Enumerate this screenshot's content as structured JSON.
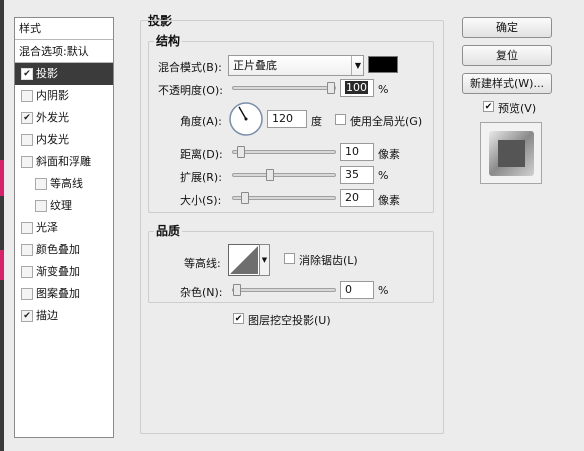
{
  "window": {
    "accent_color": "#3b3b3b"
  },
  "sidebar": {
    "header": "样式",
    "items": [
      {
        "label": "混合选项:默认",
        "checkbox": false,
        "checked": false,
        "selected": false
      },
      {
        "label": "投影",
        "checkbox": true,
        "checked": true,
        "selected": true
      },
      {
        "label": "内阴影",
        "checkbox": true,
        "checked": false,
        "selected": false
      },
      {
        "label": "外发光",
        "checkbox": true,
        "checked": true,
        "selected": false
      },
      {
        "label": "内发光",
        "checkbox": true,
        "checked": false,
        "selected": false
      },
      {
        "label": "斜面和浮雕",
        "checkbox": true,
        "checked": false,
        "selected": false
      },
      {
        "label": "等高线",
        "checkbox": true,
        "checked": false,
        "selected": false,
        "indent": true
      },
      {
        "label": "纹理",
        "checkbox": true,
        "checked": false,
        "selected": false,
        "indent": true
      },
      {
        "label": "光泽",
        "checkbox": true,
        "checked": false,
        "selected": false
      },
      {
        "label": "颜色叠加",
        "checkbox": true,
        "checked": false,
        "selected": false
      },
      {
        "label": "渐变叠加",
        "checkbox": true,
        "checked": false,
        "selected": false
      },
      {
        "label": "图案叠加",
        "checkbox": true,
        "checked": false,
        "selected": false
      },
      {
        "label": "描边",
        "checkbox": true,
        "checked": true,
        "selected": false
      }
    ]
  },
  "section": {
    "title": "投影"
  },
  "structure": {
    "title": "结构",
    "blend_mode_label": "混合模式(B):",
    "blend_mode_value": "正片叠底",
    "blend_color": "#000000",
    "opacity_label": "不透明度(O):",
    "opacity_value": "100",
    "opacity_level": 1.0,
    "opacity_unit": "%",
    "angle_label": "角度(A):",
    "angle_value": "120",
    "angle_unit": "度",
    "global_light_label": "使用全局光(G)",
    "global_light_checked": false,
    "distance_label": "距离(D):",
    "distance_value": "10",
    "distance_level": 0.04,
    "distance_unit": "像素",
    "spread_label": "扩展(R):",
    "spread_value": "35",
    "spread_level": 0.35,
    "spread_unit": "%",
    "size_label": "大小(S):",
    "size_value": "20",
    "size_level": 0.08,
    "size_unit": "像素"
  },
  "quality": {
    "title": "品质",
    "contour_label": "等高线:",
    "antialias_label": "消除锯齿(L)",
    "antialias_checked": false,
    "noise_label": "杂色(N):",
    "noise_value": "0",
    "noise_level": 0.0,
    "noise_unit": "%"
  },
  "knockout": {
    "label": "图层挖空投影(U)",
    "checked": true
  },
  "buttons": {
    "ok": "确定",
    "reset": "复位",
    "new_style": "新建样式(W)...",
    "preview_label": "预览(V)",
    "preview_checked": true
  }
}
